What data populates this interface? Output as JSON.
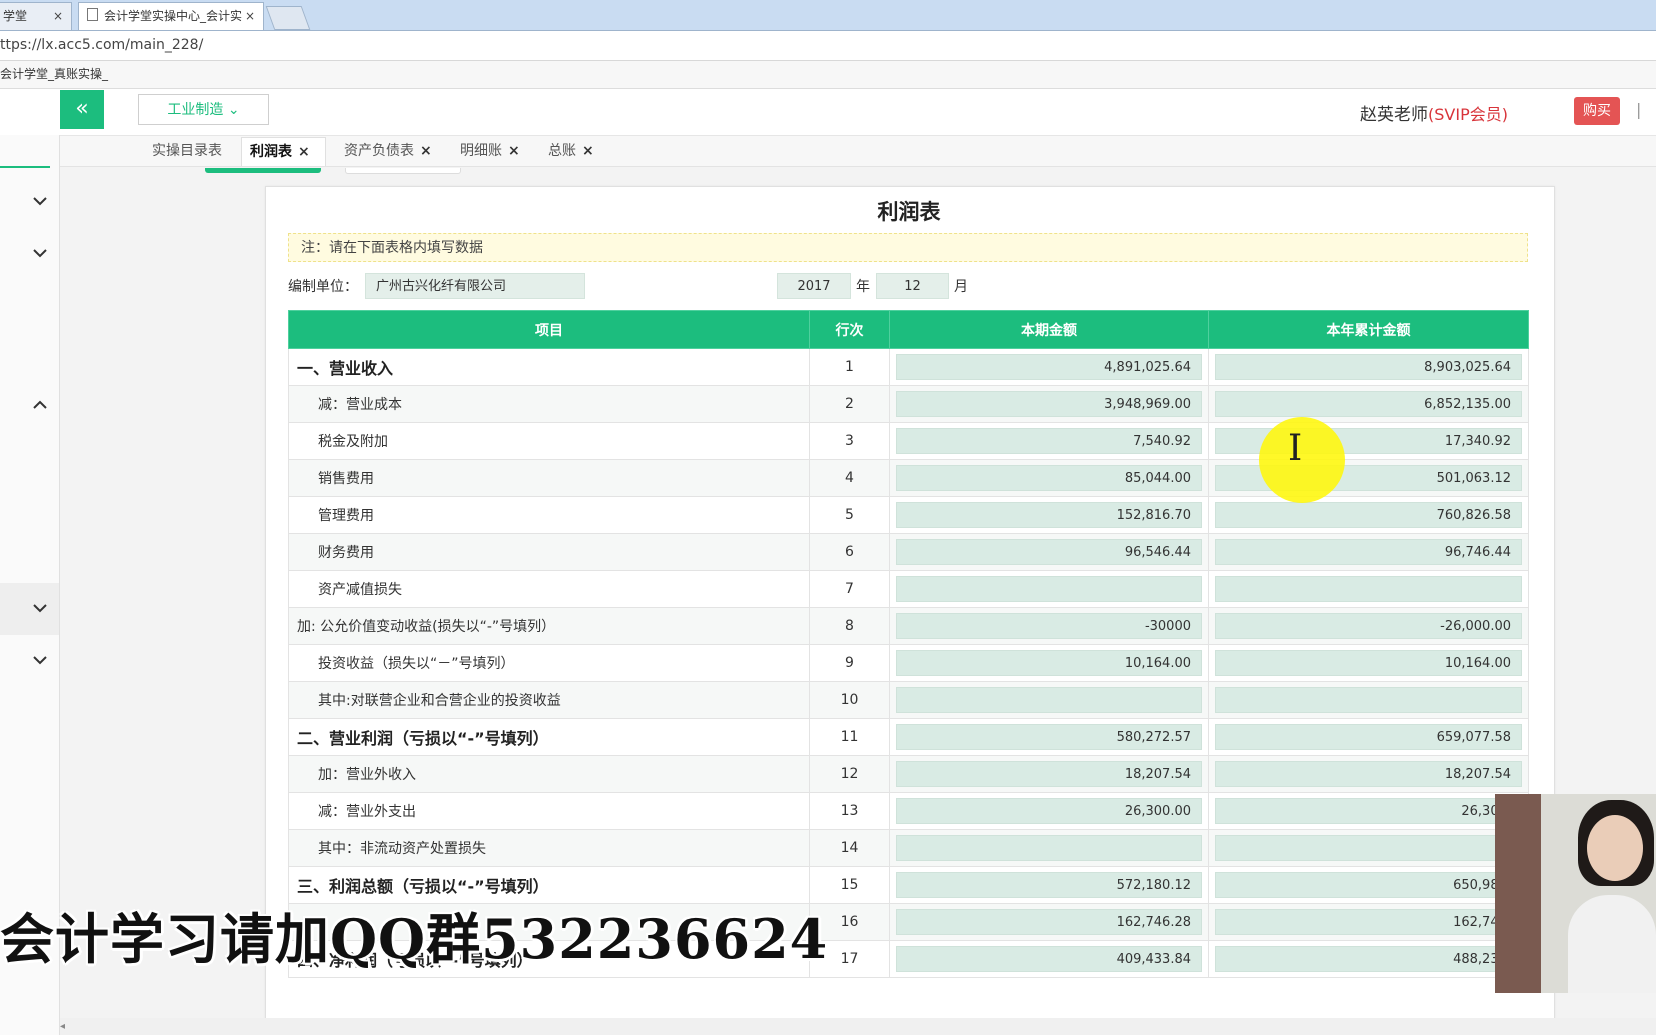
{
  "browser": {
    "tabs": [
      {
        "label": "学堂",
        "close": "×"
      },
      {
        "label": "会计学堂实操中心_会计实",
        "close": "×"
      }
    ],
    "url": "ttps://lx.acc5.com/main_228/",
    "bookmark": "会计学堂_真账实操_"
  },
  "header": {
    "collapse_icon": "«",
    "industry_label": "工业制造",
    "industry_caret": "⌄",
    "teacher_name": "赵英老师",
    "vip_label": "(SVIP会员)",
    "buy_label": "购买",
    "separator": "|"
  },
  "tabs": [
    {
      "label": "实操目录表",
      "close": ""
    },
    {
      "label": "利润表",
      "close": "×",
      "active": true
    },
    {
      "label": "资产负债表",
      "close": "×"
    },
    {
      "label": "明细账",
      "close": "×"
    },
    {
      "label": "总账",
      "close": "×"
    }
  ],
  "report": {
    "title": "利润表",
    "note": "注：请在下面表格内填写数据",
    "company_label": "编制单位：",
    "company_value": "广州古兴化纤有限公司",
    "year_value": "2017",
    "year_label": "年",
    "month_value": "12",
    "month_label": "月",
    "columns": [
      "项目",
      "行次",
      "本期金额",
      "本年累计金额"
    ],
    "rows": [
      {
        "item": "一、营业收入",
        "row": "1",
        "current": "4,891,025.64",
        "ytd": "8,903,025.64",
        "style": "bold"
      },
      {
        "item": "减：营业成本",
        "row": "2",
        "current": "3,948,969.00",
        "ytd": "6,852,135.00",
        "style": "sub"
      },
      {
        "item": "税金及附加",
        "row": "3",
        "current": "7,540.92",
        "ytd": "17,340.92",
        "style": "sub"
      },
      {
        "item": "销售费用",
        "row": "4",
        "current": "85,044.00",
        "ytd": "501,063.12",
        "style": "sub"
      },
      {
        "item": "管理费用",
        "row": "5",
        "current": "152,816.70",
        "ytd": "760,826.58",
        "style": "sub"
      },
      {
        "item": "财务费用",
        "row": "6",
        "current": "96,546.44",
        "ytd": "96,746.44",
        "style": "sub"
      },
      {
        "item": "资产减值损失",
        "row": "7",
        "current": "",
        "ytd": "",
        "style": "sub"
      },
      {
        "item": "加: 公允价值变动收益(损失以“-”号填列）",
        "row": "8",
        "current": "-30000",
        "ytd": "-26,000.00",
        "style": "plain"
      },
      {
        "item": "投资收益（损失以“－”号填列）",
        "row": "9",
        "current": "10,164.00",
        "ytd": "10,164.00",
        "style": "sub"
      },
      {
        "item": "其中:对联营企业和合营企业的投资收益",
        "row": "10",
        "current": "",
        "ytd": "",
        "style": "sub"
      },
      {
        "item": "二、营业利润（亏损以“-”号填列）",
        "row": "11",
        "current": "580,272.57",
        "ytd": "659,077.58",
        "style": "bold"
      },
      {
        "item": "加：营业外收入",
        "row": "12",
        "current": "18,207.54",
        "ytd": "18,207.54",
        "style": "sub"
      },
      {
        "item": "减：营业外支出",
        "row": "13",
        "current": "26,300.00",
        "ytd": "26,300.",
        "style": "sub"
      },
      {
        "item": "其中：非流动资产处置损失",
        "row": "14",
        "current": "",
        "ytd": "",
        "style": "sub"
      },
      {
        "item": "三、利润总额（亏损以“-”号填列）",
        "row": "15",
        "current": "572,180.12",
        "ytd": "650,985.",
        "style": "bold"
      },
      {
        "item": "",
        "row": "16",
        "current": "162,746.28",
        "ytd": "162,746.",
        "style": "sub"
      },
      {
        "item": "四、净利润（亏损以“-”号填列）",
        "row": "17",
        "current": "409,433.84",
        "ytd": "488,238.",
        "style": "bold"
      }
    ]
  },
  "overlay": {
    "watermark": "会计学习请加QQ群532236624",
    "cursor_glyph": "I"
  },
  "colors": {
    "accent": "#1cbd7e",
    "vip": "#d8343a",
    "buy": "#e45454"
  }
}
